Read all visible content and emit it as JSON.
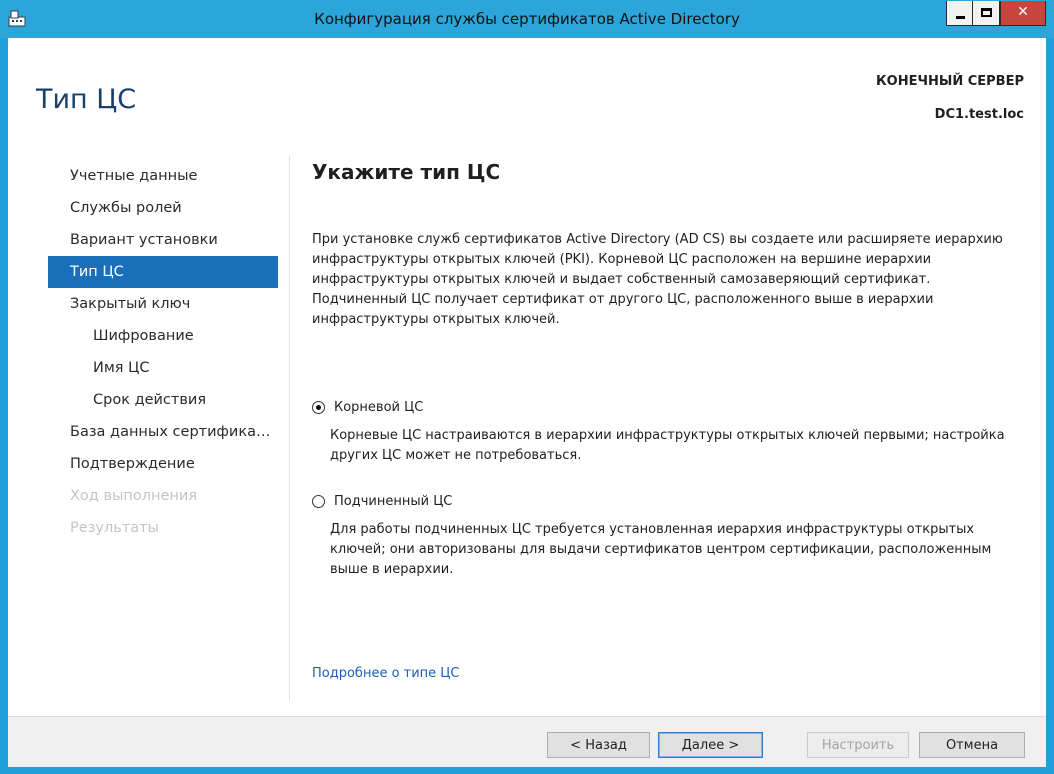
{
  "window": {
    "title": "Конфигурация службы сертификатов Active Directory"
  },
  "header": {
    "page_title": "Тип ЦС",
    "destination_label": "КОНЕЧНЫЙ СЕРВЕР",
    "destination_server": "DC1.test.loc"
  },
  "nav": {
    "items": [
      {
        "label": "Учетные данные",
        "state": "normal"
      },
      {
        "label": "Службы ролей",
        "state": "normal"
      },
      {
        "label": "Вариант установки",
        "state": "normal"
      },
      {
        "label": "Тип ЦС",
        "state": "active"
      },
      {
        "label": "Закрытый ключ",
        "state": "normal"
      },
      {
        "label": "Шифрование",
        "state": "sub"
      },
      {
        "label": "Имя ЦС",
        "state": "sub"
      },
      {
        "label": "Срок действия",
        "state": "sub"
      },
      {
        "label": "База данных сертификат...",
        "state": "normal"
      },
      {
        "label": "Подтверждение",
        "state": "normal"
      },
      {
        "label": "Ход выполнения",
        "state": "disabled"
      },
      {
        "label": "Результаты",
        "state": "disabled"
      }
    ]
  },
  "content": {
    "heading": "Укажите тип ЦС",
    "intro": "При установке служб сертификатов Active Directory (AD CS) вы создаете или расширяете иерархию инфраструктуры открытых ключей (PKI). Корневой ЦС расположен на вершине иерархии инфраструктуры открытых ключей и выдает собственный самозаверяющий сертификат. Подчиненный ЦС получает сертификат от другого ЦС, расположенного выше в иерархии инфраструктуры открытых ключей.",
    "options": [
      {
        "label": "Корневой ЦС",
        "checked": true,
        "description": "Корневые ЦС настраиваются в иерархии инфраструктуры открытых ключей первыми; настройка других ЦС может не потребоваться."
      },
      {
        "label": "Подчиненный ЦС",
        "checked": false,
        "description": "Для работы подчиненных ЦС требуется установленная иерархия инфраструктуры открытых ключей; они авторизованы для выдачи сертификатов центром сертификации, расположенным выше в иерархии."
      }
    ],
    "more_link": "Подробнее о типе ЦС"
  },
  "footer": {
    "back_label": "< Назад",
    "next_label": "Далее >",
    "configure_label": "Настроить",
    "cancel_label": "Отмена"
  }
}
